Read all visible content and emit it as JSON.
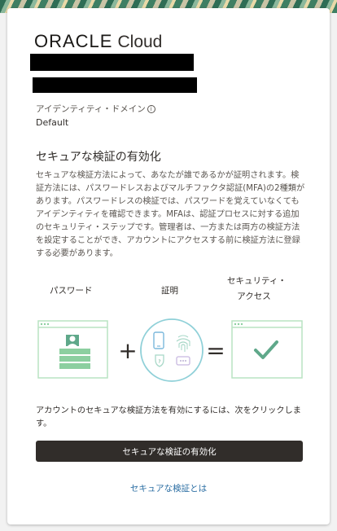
{
  "logo": {
    "oracle": "ORACLE",
    "cloud": "Cloud"
  },
  "identity_domain": {
    "label": "アイデンティティ・ドメイン",
    "value": "Default",
    "info_icon": "i"
  },
  "heading": "セキュアな検証の有効化",
  "description": "セキュアな検証方法によって、あなたが誰であるかが証明されます。検証方法には、パスワードレスおよびマルチファクタ認証(MFA)の2種類があります。パスワードレスの検証では、パスワードを覚えていなくてもアイデンティティを確認できます。MFAは、認証プロセスに対する追加のセキュリティ・ステップです。管理者は、一方または両方の検証方法を設定することができ、アカウントにアクセスする前に検証方法に登録する必要があります。",
  "steps": {
    "password": "パスワード",
    "proof": "証明",
    "security": "セキュリティ・",
    "access": "アクセス"
  },
  "symbols": {
    "plus": "+",
    "equals": "="
  },
  "tail": "アカウントのセキュアな検証方法を有効にするには、次をクリックします。",
  "button": "セキュアな検証の有効化",
  "link": "セキュアな検証とは",
  "colors": {
    "accent_green": "#8ccfa0",
    "check": "#5fa88a",
    "button_bg": "#312d2a",
    "link": "#2b6ea3"
  },
  "icons": [
    "info-icon",
    "user-icon",
    "phone-icon",
    "fingerprint-icon",
    "shield-icon",
    "chat-icon",
    "checkmark-icon"
  ]
}
